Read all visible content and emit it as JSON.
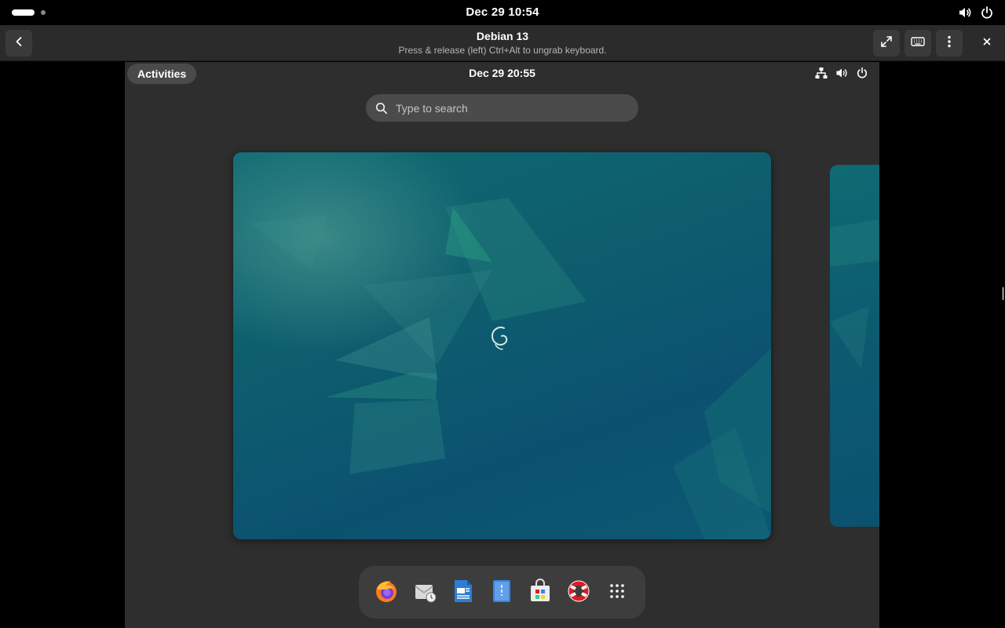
{
  "host": {
    "clock": "Dec 29  10:54",
    "status_icons": [
      "volume-icon",
      "power-icon"
    ]
  },
  "headerbar": {
    "title": "Debian 13",
    "subtitle": "Press & release (left) Ctrl+Alt to ungrab keyboard.",
    "buttons": [
      "back-icon",
      "fullscreen-icon",
      "keyboard-icon",
      "menu-icon",
      "close-icon"
    ]
  },
  "guest": {
    "activities_label": "Activities",
    "clock": "Dec 29  20:55",
    "status_icons": [
      "network-icon",
      "volume-icon",
      "power-icon"
    ],
    "search": {
      "placeholder": "Type to search",
      "value": ""
    },
    "dock": [
      "firefox-icon",
      "evolution-icon",
      "writer-icon",
      "text-editor-icon",
      "software-icon",
      "help-icon",
      "app-grid-icon"
    ]
  },
  "colors": {
    "host_bar": "#000000",
    "headerbar": "#2b2b2b",
    "guest_bg": "#2e2e2e",
    "wallpaper": "#0e5f6e",
    "dock": "#3d3d3d"
  }
}
